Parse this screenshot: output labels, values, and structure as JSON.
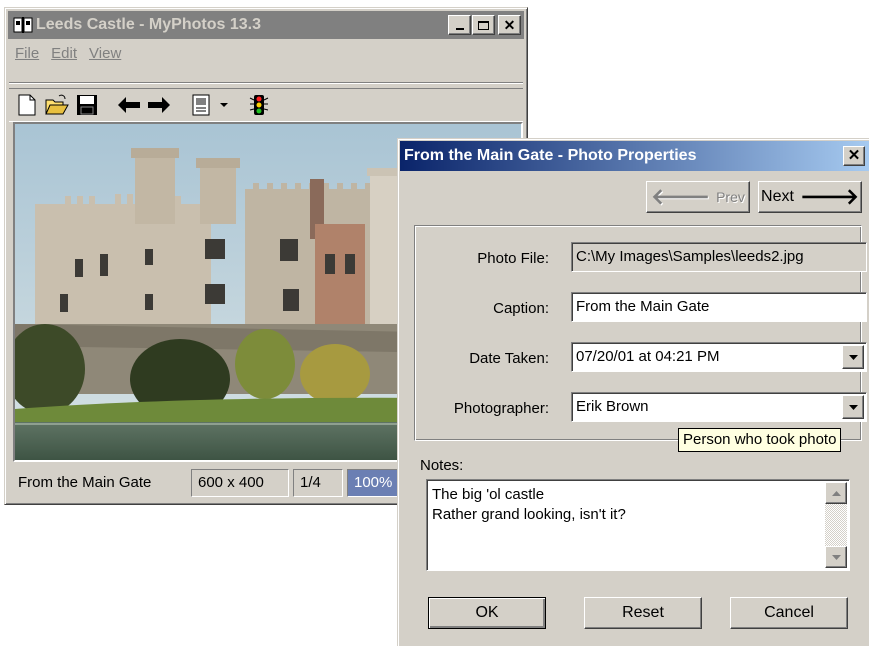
{
  "main_window": {
    "title": "Leeds Castle - MyPhotos 13.3",
    "menu": [
      "File",
      "Edit",
      "View"
    ],
    "toolbar_icons": [
      "new-icon",
      "open-icon",
      "save-icon",
      "back-arrow-icon",
      "forward-arrow-icon",
      "image-list-icon",
      "traffic-light-icon"
    ],
    "status": {
      "caption": "From the Main Gate",
      "size": "600 x 400",
      "index": "1/4",
      "zoom": "100%"
    }
  },
  "dialog": {
    "title": "From the Main Gate - Photo Properties",
    "prev_label": "Prev",
    "next_label": "Next",
    "photo_file_label": "Photo File:",
    "photo_file_value": "C:\\My Images\\Samples\\leeds2.jpg",
    "caption_label": "Caption:",
    "caption_value": "From the Main Gate",
    "date_label": "Date Taken:",
    "date_value": "07/20/01 at 04:21 PM",
    "photographer_label": "Photographer:",
    "photographer_value": "Erik Brown",
    "tooltip": "Person who took photo",
    "notes_label": "Notes:",
    "notes_line1": "The big 'ol castle",
    "notes_line2": "Rather grand looking, isn't it?",
    "ok_label": "OK",
    "reset_label": "Reset",
    "cancel_label": "Cancel"
  },
  "colors": {
    "active_title_start": "#0a246a",
    "active_title_end": "#a6caf0",
    "inactive_title": "#808080",
    "face": "#d4d0c8",
    "tooltip_bg": "#ffffe1"
  }
}
